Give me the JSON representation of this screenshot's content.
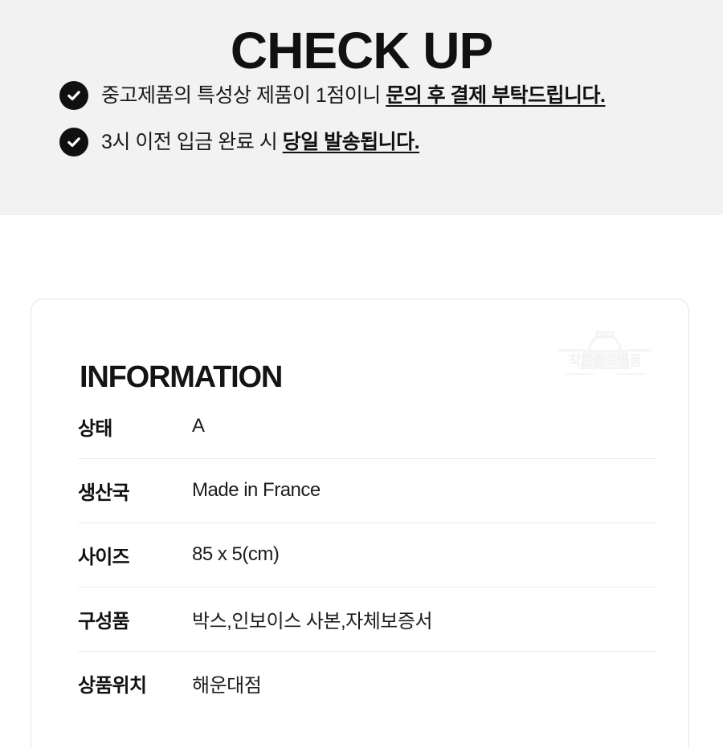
{
  "checkup": {
    "title": "CHECK UP",
    "items": [
      {
        "icon": "check-circle-icon",
        "text_plain": "중고제품의 특성상 제품이 1점이니 ",
        "text_emphasis": "문의 후 결제 부탁드립니다."
      },
      {
        "icon": "check-circle-icon",
        "text_plain": "3시 이전 입금 완료 시 ",
        "text_emphasis": "당일 발송됩니다."
      }
    ]
  },
  "information": {
    "title": "INFORMATION",
    "watermark": {
      "icon": "handbag-icon",
      "text": "착한중고명품"
    },
    "rows": [
      {
        "label": "상태",
        "value": "A"
      },
      {
        "label": "생산국",
        "value": "Made in France"
      },
      {
        "label": "사이즈",
        "value": "85 x 5(cm)"
      },
      {
        "label": "구성품",
        "value": "박스,인보이스 사본,자체보증서"
      },
      {
        "label": "상품위치",
        "value": "해운대점"
      }
    ]
  },
  "colors": {
    "band_background": "#f2f2f2",
    "page_background": "#ffffff",
    "text_primary": "#111111",
    "icon_fill": "#101010",
    "card_border": "#e4e4e4",
    "row_divider": "#ebebeb",
    "watermark": "#f7f7f7"
  }
}
